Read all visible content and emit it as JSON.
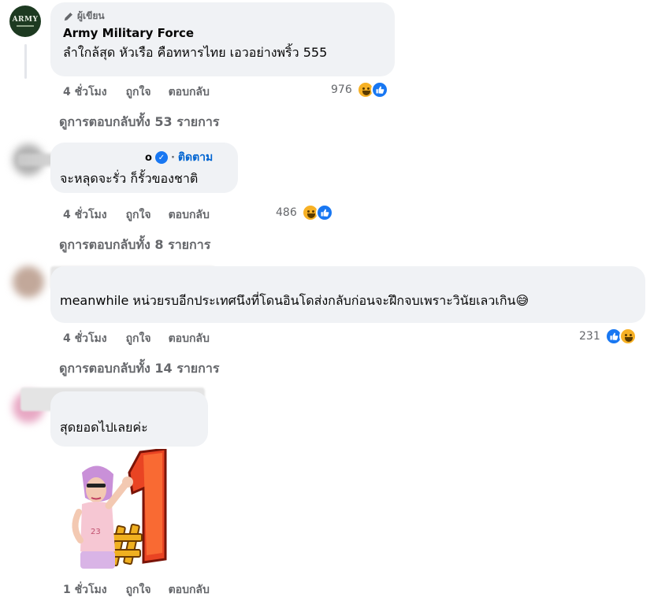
{
  "comments": [
    {
      "author": "Army Military Force",
      "badge": "ผู้เขียน",
      "avatar_text": "ARMY",
      "text": "ลำใกล้สุด หัวเรือ คือทหารไทย เอวอย่างพริ้ว 555",
      "time": "4 ชั่วโมง",
      "like": "ถูกใจ",
      "reply": "ตอบกลับ",
      "reaction_count": "976",
      "view_replies": "ดูการตอบกลับทั้ง 53 รายการ"
    },
    {
      "author_tail": "o",
      "follow": "ติดตาม",
      "text": "จะหลุดจะรั่ว ก็รั้วของชาติ",
      "time": "4 ชั่วโมง",
      "like": "ถูกใจ",
      "reply": "ตอบกลับ",
      "reaction_count": "486",
      "view_replies": "ดูการตอบกลับทั้ง 8 รายการ"
    },
    {
      "text": "meanwhile หน่วยรบอีกประเทศนึงที่โดนอินโดส่งกลับก่อนจะฝึกจบเพราะวินัยเลวเกิน😅",
      "time": "4 ชั่วโมง",
      "like": "ถูกใจ",
      "reply": "ตอบกลับ",
      "reaction_count": "231",
      "view_replies": "ดูการตอบกลับทั้ง 14 รายการ"
    },
    {
      "text": "สุดยอดไปเลยค่ะ",
      "sticker": "#1",
      "time": "1 ชั่วโมง",
      "like": "ถูกใจ",
      "reply": "ตอบกลับ"
    }
  ],
  "icons": {
    "badge": "pencil-icon",
    "verified": "verified-badge-icon",
    "reaction_haha": "haha-emoji-icon",
    "reaction_like": "like-thumb-icon"
  },
  "colors": {
    "bubble": "#f0f2f5",
    "meta": "#65676b",
    "link": "#0064d1",
    "like_blue": "#1877f2",
    "haha_yellow": "#f7b125"
  }
}
